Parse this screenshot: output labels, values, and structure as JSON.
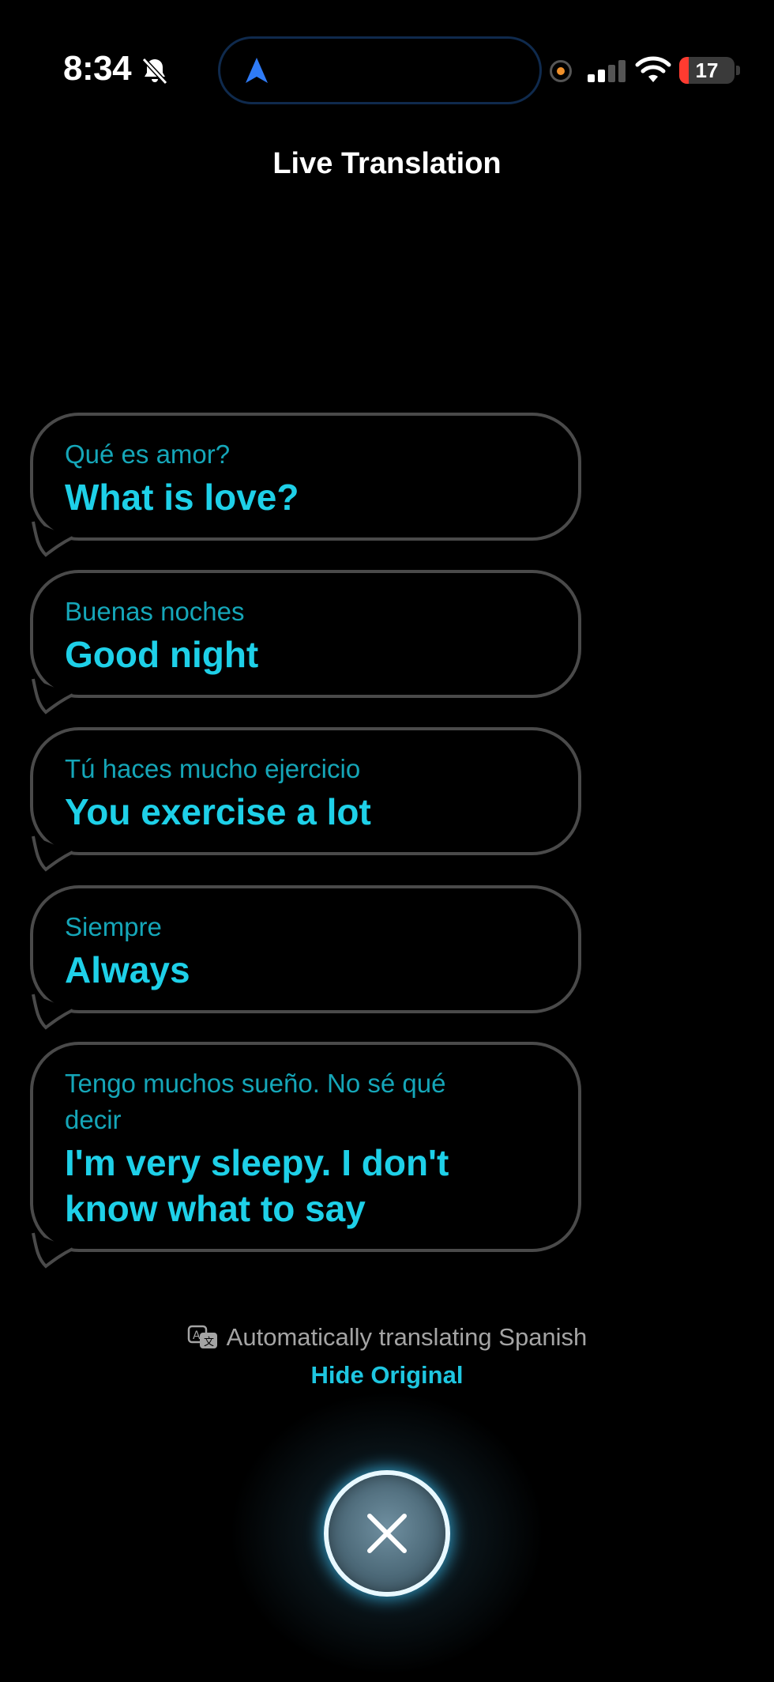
{
  "status_bar": {
    "time": "8:34",
    "battery": "17",
    "battery_level_percent": 17
  },
  "header": {
    "title": "Live Translation"
  },
  "messages": [
    {
      "original": "Qué es amor?",
      "translation": "What is love?"
    },
    {
      "original": "Buenas noches",
      "translation": "Good night"
    },
    {
      "original": "Tú haces mucho ejercicio",
      "translation": "You exercise a lot"
    },
    {
      "original": "Siempre",
      "translation": "Always"
    },
    {
      "original": "Tengo muchos sueño. No sé qué decir",
      "translation": "I'm very sleepy. I don't know what to say"
    }
  ],
  "footer": {
    "status": "Automatically translating Spanish",
    "hide_original_label": "Hide Original"
  },
  "colors": {
    "original_text": "#15a6b8",
    "translated_text": "#1ed0e8",
    "bubble_border": "#4a4a4a",
    "accent": "#1ec6e0",
    "battery_low": "#ff3b30"
  },
  "icons": {
    "silent": "bell-slash-icon",
    "navigation": "location-arrow-icon",
    "signal": "cellular-signal-icon",
    "wifi": "wifi-icon",
    "battery": "battery-icon",
    "translate": "translate-icon",
    "close": "close-icon"
  }
}
